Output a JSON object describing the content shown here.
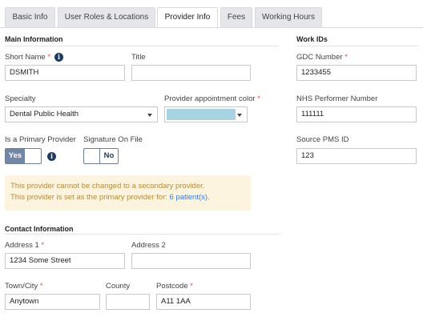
{
  "tabs": [
    {
      "label": "Basic Info"
    },
    {
      "label": "User Roles & Locations"
    },
    {
      "label": "Provider Info"
    },
    {
      "label": "Fees"
    },
    {
      "label": "Working Hours"
    }
  ],
  "main_info": {
    "title": "Main Information",
    "short_name": {
      "label": "Short Name",
      "value": "DSMITH"
    },
    "title_field": {
      "label": "Title",
      "value": ""
    },
    "specialty": {
      "label": "Specialty",
      "value": "Dental Public Health"
    },
    "appointment_color": {
      "label": "Provider appointment color",
      "color": "#a8d4e2"
    },
    "primary_provider": {
      "label": "Is a Primary Provider",
      "on_label": "Yes",
      "value": "Yes"
    },
    "signature_on_file": {
      "label": "Signature On File",
      "off_label": "No",
      "value": "No"
    }
  },
  "alert": {
    "line1": "This provider cannot be changed to a secondary provider.",
    "line2_prefix": "This provider is set as the primary provider for: ",
    "line2_link": "6 patient(s)",
    "line2_suffix": "."
  },
  "contact_info": {
    "title": "Contact Information",
    "address1": {
      "label": "Address 1",
      "value": "1234 Some Street"
    },
    "address2": {
      "label": "Address 2",
      "value": ""
    },
    "town": {
      "label": "Town/City",
      "value": "Anytown"
    },
    "county": {
      "label": "County",
      "value": ""
    },
    "postcode": {
      "label": "Postcode",
      "value": "A11 1AA"
    }
  },
  "work_ids": {
    "title": "Work IDs",
    "gdc_number": {
      "label": "GDC Number",
      "value": "1233455"
    },
    "nhs_performer": {
      "label": "NHS Performer Number",
      "value": "111111"
    },
    "source_pms": {
      "label": "Source PMS ID",
      "value": "123"
    }
  },
  "required_mark": "*",
  "info_glyph": "i",
  "colors": {
    "accent": "#1e3a5f",
    "toggle_on": "#7287a6",
    "alert_bg": "#fdf4df",
    "alert_text": "#b38a3d",
    "link": "#3a7bd5",
    "required": "#d9534f"
  }
}
